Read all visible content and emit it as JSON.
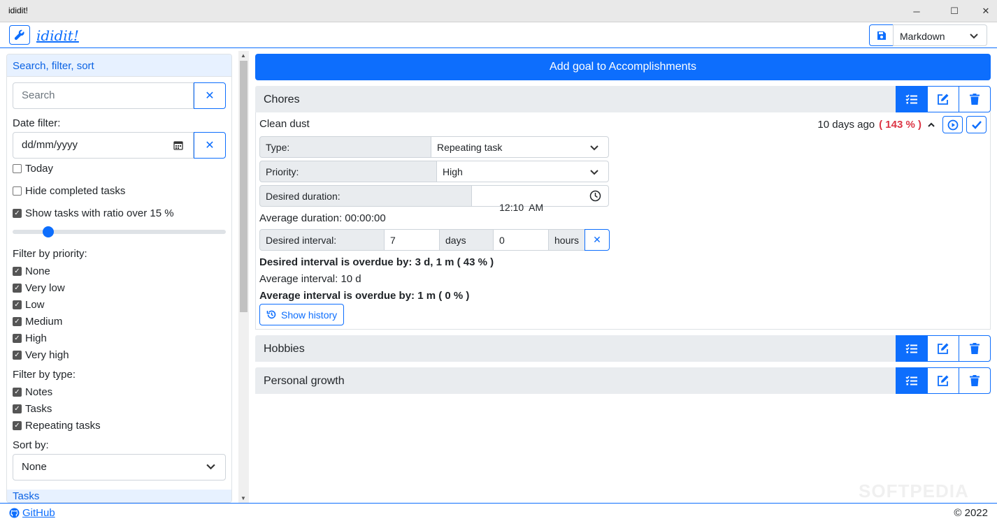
{
  "window": {
    "title": "ididit!",
    "minimize": "─",
    "maximize": "☐",
    "close": "✕"
  },
  "header": {
    "app_name": "ididit!",
    "format": "Markdown"
  },
  "sidebar": {
    "heading": "Search, filter, sort",
    "search_placeholder": "Search",
    "date_filter_label": "Date filter:",
    "date_placeholder": "dd/mm/yyyy",
    "today": "Today",
    "hide_completed": "Hide completed tasks",
    "show_ratio": "Show tasks with ratio over 15 %",
    "ratio_value": 0.15,
    "priority_label": "Filter by priority:",
    "priorities": [
      "None",
      "Very low",
      "Low",
      "Medium",
      "High",
      "Very high"
    ],
    "type_label": "Filter by type:",
    "types": [
      "Notes",
      "Tasks",
      "Repeating tasks"
    ],
    "sort_label": "Sort by:",
    "sort_value": "None",
    "next_section": "Tasks"
  },
  "main": {
    "add_goal": "Add goal to Accomplishments",
    "categories": [
      "Chores",
      "Hobbies",
      "Personal growth"
    ],
    "task": {
      "name": "Clean dust",
      "ago": "10 days ago",
      "ratio": "( 143 % )",
      "type_label": "Type:",
      "type_value": "Repeating task",
      "priority_label": "Priority:",
      "priority_value": "High",
      "duration_label": "Desired duration:",
      "duration_value": "12:10  AM",
      "avg_duration": "Average duration: 00:00:00",
      "interval_label": "Desired interval:",
      "interval_days": "7",
      "days_unit": "days",
      "interval_hours": "0",
      "hours_unit": "hours",
      "overdue_desired": "Desired interval is overdue by: 3 d, 1 m ( 43 % )",
      "avg_interval": "Average interval: 10 d",
      "overdue_avg": "Average interval is overdue by: 1 m ( 0 % )",
      "show_history": "Show history"
    }
  },
  "footer": {
    "github": "GitHub",
    "copyright": "© 2022"
  },
  "watermark": "SOFTPEDIA",
  "colors": {
    "primary": "#0d6efd",
    "danger": "#dc3545"
  }
}
